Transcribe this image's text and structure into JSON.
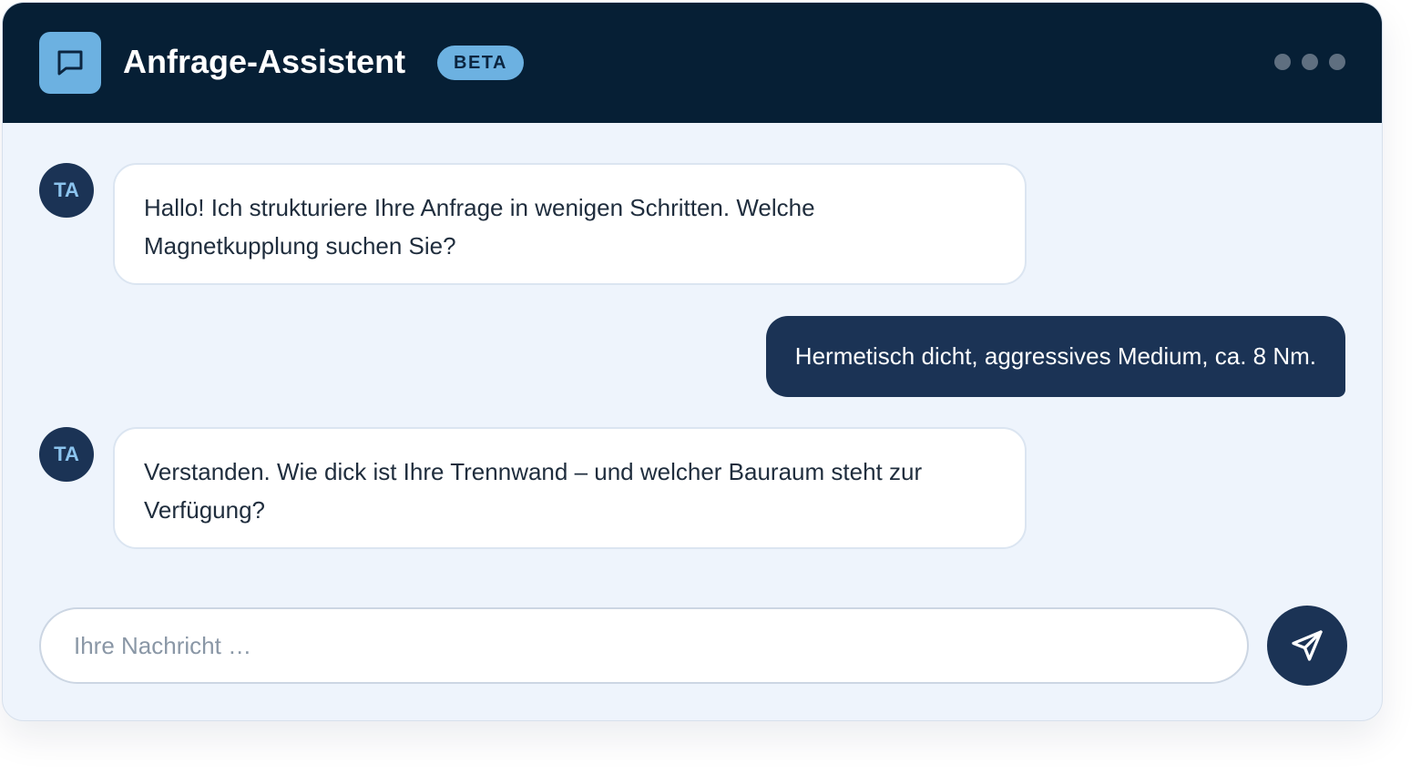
{
  "header": {
    "title": "Anfrage-Assistent",
    "badge": "BETA",
    "app_icon": "chat-bubble-icon",
    "menu_icon": "more-dots-icon"
  },
  "messages": [
    {
      "role": "assistant",
      "avatar": "TA",
      "text": "Hallo! Ich strukturiere Ihre Anfrage in wenigen Schritten. Welche Magnetkupplung suchen Sie?"
    },
    {
      "role": "user",
      "text": "Hermetisch dicht, aggressives Medium, ca. 8 Nm."
    },
    {
      "role": "assistant",
      "avatar": "TA",
      "text": "Verstanden. Wie dick ist Ihre Trennwand – und welcher Bauraum steht zur Verfügung?"
    }
  ],
  "composer": {
    "placeholder": "Ihre Nachricht …",
    "value": "",
    "send_icon": "send-icon"
  },
  "colors": {
    "header_bg": "#061f35",
    "accent": "#6cb1e1",
    "navy": "#1b3355",
    "chat_bg": "#eef4fc"
  }
}
